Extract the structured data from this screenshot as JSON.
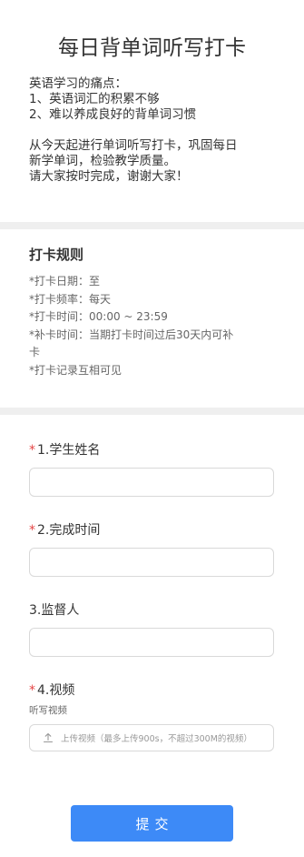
{
  "header": {
    "title": "每日背单词听写打卡"
  },
  "intro": {
    "lines_1": [
      "英语学习的痛点：",
      "1、英语词汇的积累不够",
      "2、难以养成良好的背单词习惯"
    ],
    "lines_2": [
      "从今天起进行单词听写打卡，巩固每日",
      "新学单词，检验教学质量。",
      "请大家按时完成，谢谢大家！"
    ]
  },
  "rules": {
    "title": "打卡规则",
    "items": [
      "*打卡日期：至",
      "*打卡频率：每天",
      "*打卡时间：00:00 ~ 23:59",
      "*补卡时间：当期打卡时间过后30天内可补",
      "卡",
      "*打卡记录互相可见"
    ]
  },
  "form": {
    "required_mark": "*",
    "fields": [
      {
        "label": "1.学生姓名",
        "required": true,
        "value": "",
        "placeholder": ""
      },
      {
        "label": "2.完成时间",
        "required": true,
        "value": "",
        "placeholder": ""
      },
      {
        "label": "3.监督人",
        "required": false,
        "value": "",
        "placeholder": ""
      }
    ],
    "video": {
      "label": "4.视频",
      "required": true,
      "description": "听写视频",
      "upload_text": "上传视频（最多上传900s，不超过300M的视频）",
      "upload_icon": "upload-icon"
    },
    "submit_label": "提交"
  },
  "colors": {
    "accent": "#3d8af7",
    "required": "#e54545",
    "divider": "#efefef"
  }
}
